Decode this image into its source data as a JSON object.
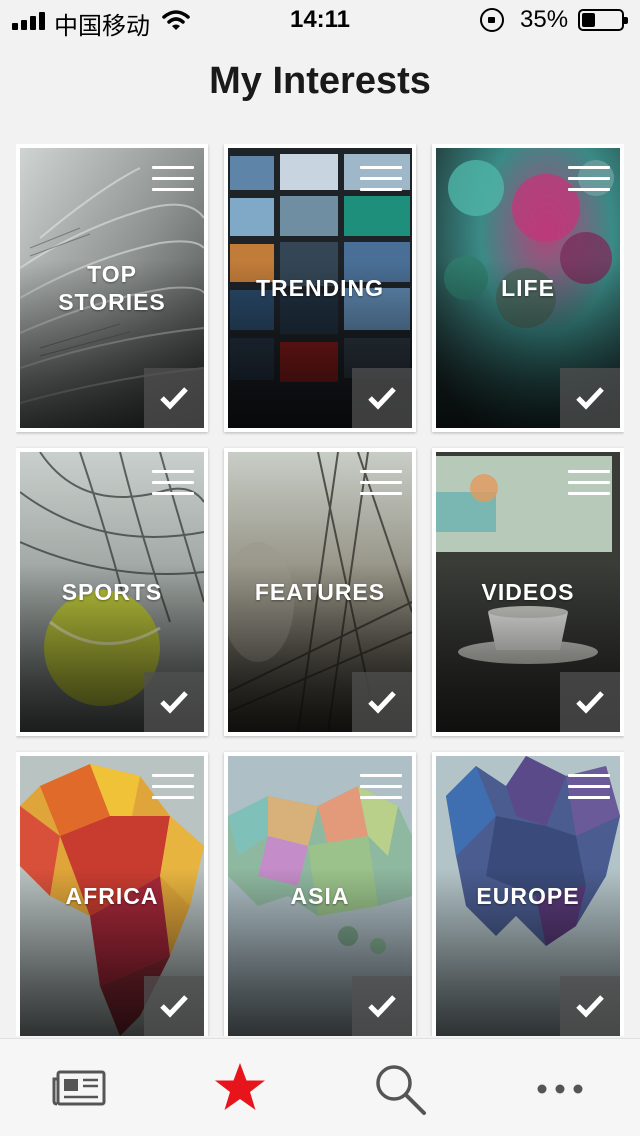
{
  "status_bar": {
    "carrier": "中国移动",
    "time": "14:11",
    "battery_percent": "35%",
    "battery_level": 0.35,
    "signal_bars": 4,
    "icons": [
      "signal-icon",
      "wifi-icon",
      "rotation-lock-icon",
      "battery-icon"
    ]
  },
  "page": {
    "title": "My Interests"
  },
  "tiles": [
    {
      "label": "TOP\nSTORIES",
      "selected": true,
      "theme": "newspaper"
    },
    {
      "label": "TRENDING",
      "selected": true,
      "theme": "screens"
    },
    {
      "label": "LIFE",
      "selected": true,
      "theme": "paint"
    },
    {
      "label": "SPORTS",
      "selected": true,
      "theme": "tennis"
    },
    {
      "label": "FEATURES",
      "selected": true,
      "theme": "boat"
    },
    {
      "label": "VIDEOS",
      "selected": true,
      "theme": "coffee"
    },
    {
      "label": "AFRICA",
      "selected": true,
      "theme": "africa"
    },
    {
      "label": "ASIA",
      "selected": true,
      "theme": "asia"
    },
    {
      "label": "EUROPE",
      "selected": true,
      "theme": "europe"
    }
  ],
  "tab_bar": {
    "items": [
      {
        "icon": "newspaper-icon",
        "active": false
      },
      {
        "icon": "star-icon",
        "active": true
      },
      {
        "icon": "search-icon",
        "active": false
      },
      {
        "icon": "more-icon",
        "active": false
      }
    ],
    "active_color": "#e8141c",
    "inactive_color": "#555555"
  }
}
